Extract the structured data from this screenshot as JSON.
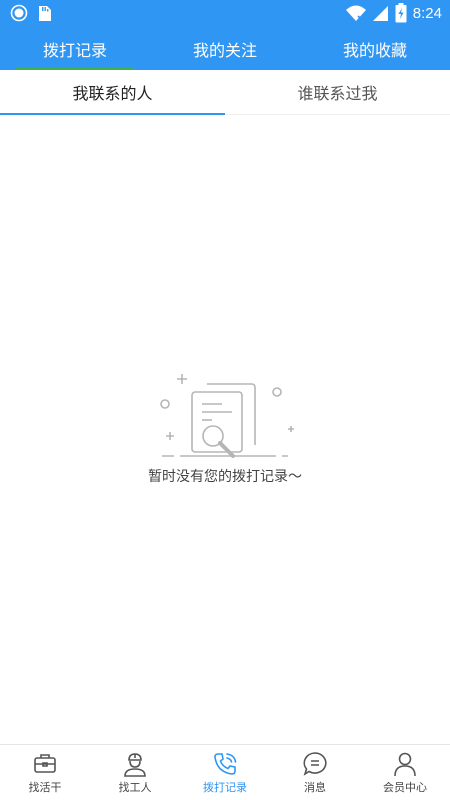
{
  "status_bar": {
    "time": "8:24",
    "icons": [
      "record-icon",
      "sd-card-icon",
      "wifi-icon",
      "signal-icon",
      "battery-icon"
    ]
  },
  "top_tabs": [
    {
      "label": "拨打记录",
      "active": true
    },
    {
      "label": "我的关注",
      "active": false
    },
    {
      "label": "我的收藏",
      "active": false
    }
  ],
  "sub_tabs": [
    {
      "label": "我联系的人",
      "active": true
    },
    {
      "label": "谁联系过我",
      "active": false
    }
  ],
  "empty_state": {
    "icon": "document-search-icon",
    "text": "暂时没有您的拨打记录～"
  },
  "bottom_nav": [
    {
      "label": "找活干",
      "icon": "briefcase-icon",
      "active": false
    },
    {
      "label": "找工人",
      "icon": "worker-icon",
      "active": false
    },
    {
      "label": "拨打记录",
      "icon": "phone-call-icon",
      "active": true
    },
    {
      "label": "消息",
      "icon": "chat-icon",
      "active": false
    },
    {
      "label": "会员中心",
      "icon": "user-icon",
      "active": false
    }
  ],
  "colors": {
    "primary": "#2f96f3",
    "active_tab_indicator": "#3ab34a",
    "sub_tab_indicator": "#2f96f3"
  }
}
